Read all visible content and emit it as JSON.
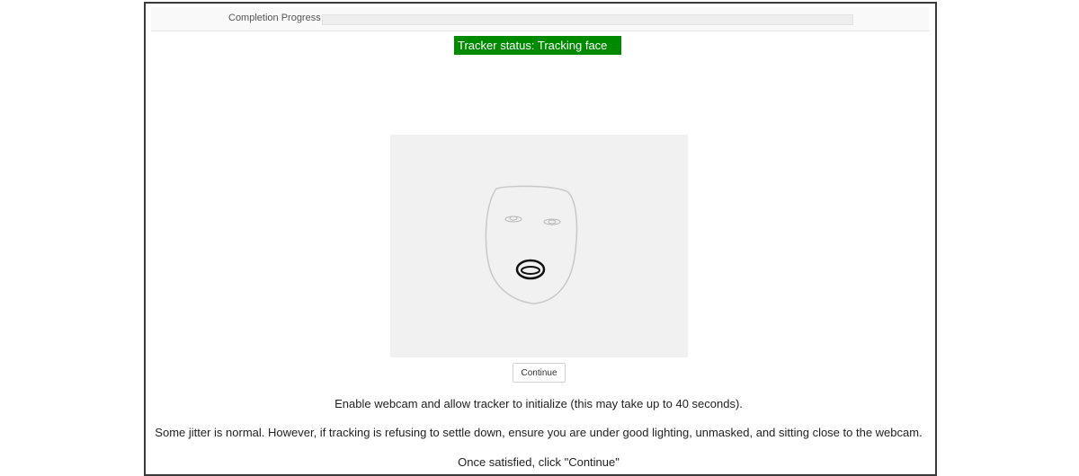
{
  "progress": {
    "label": "Completion Progress",
    "value": 0
  },
  "tracker": {
    "status": "Tracker status: Tracking face",
    "status_color": "#008a00"
  },
  "webcam": {
    "background_color": "#f1f1f1",
    "face_outline_color": "#c8c8c8",
    "mouth_color": "#111111"
  },
  "continue_button": {
    "label": "Continue"
  },
  "instructions": [
    "Enable webcam and allow tracker to initialize (this may take up to 40 seconds).",
    "Some jitter is normal. However, if tracking is refusing to settle down, ensure you are under good lighting, unmasked, and sitting close to the webcam.",
    "Once satisfied, click \"Continue\""
  ]
}
